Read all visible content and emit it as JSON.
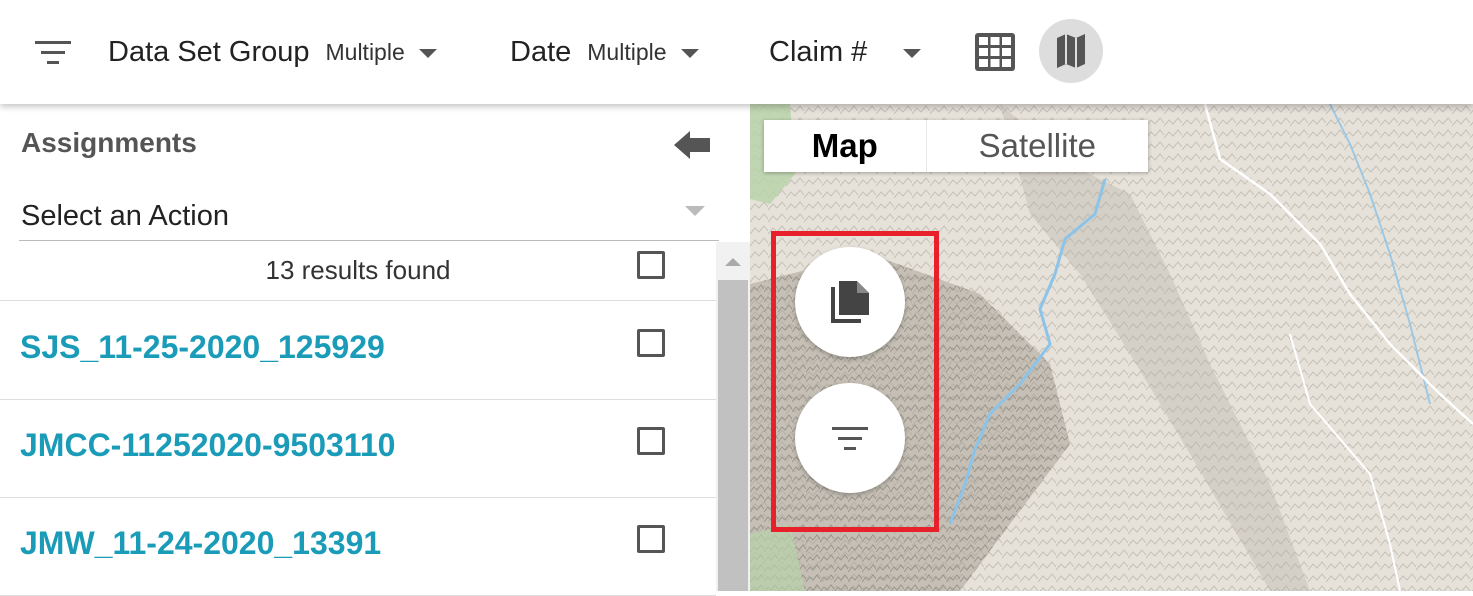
{
  "toolbar": {
    "filter_icon": "filter-list-icon",
    "filters": [
      {
        "label": "Data Set Group",
        "value": "Multiple"
      },
      {
        "label": "Date",
        "value": "Multiple"
      },
      {
        "label": "Claim #",
        "value": ""
      }
    ],
    "grid_icon": "grid-view-icon",
    "map_icon": "map-view-icon"
  },
  "panel": {
    "title": "Assignments",
    "collapse_icon": "arrow-left-icon",
    "action_select": "Select an Action",
    "results_text": "13 results found",
    "rows": [
      {
        "label": "SJS_11-25-2020_125929"
      },
      {
        "label": "JMCC-11252020-9503110"
      },
      {
        "label": "JMW_11-24-2020_13391"
      }
    ]
  },
  "map": {
    "type_options": [
      "Map",
      "Satellite"
    ],
    "selected_type": "Map",
    "fab_buttons": [
      {
        "icon": "copy-documents-icon"
      },
      {
        "icon": "filter-list-icon"
      }
    ]
  },
  "colors": {
    "link": "#1a9bb8",
    "highlight": "#e8202a"
  }
}
